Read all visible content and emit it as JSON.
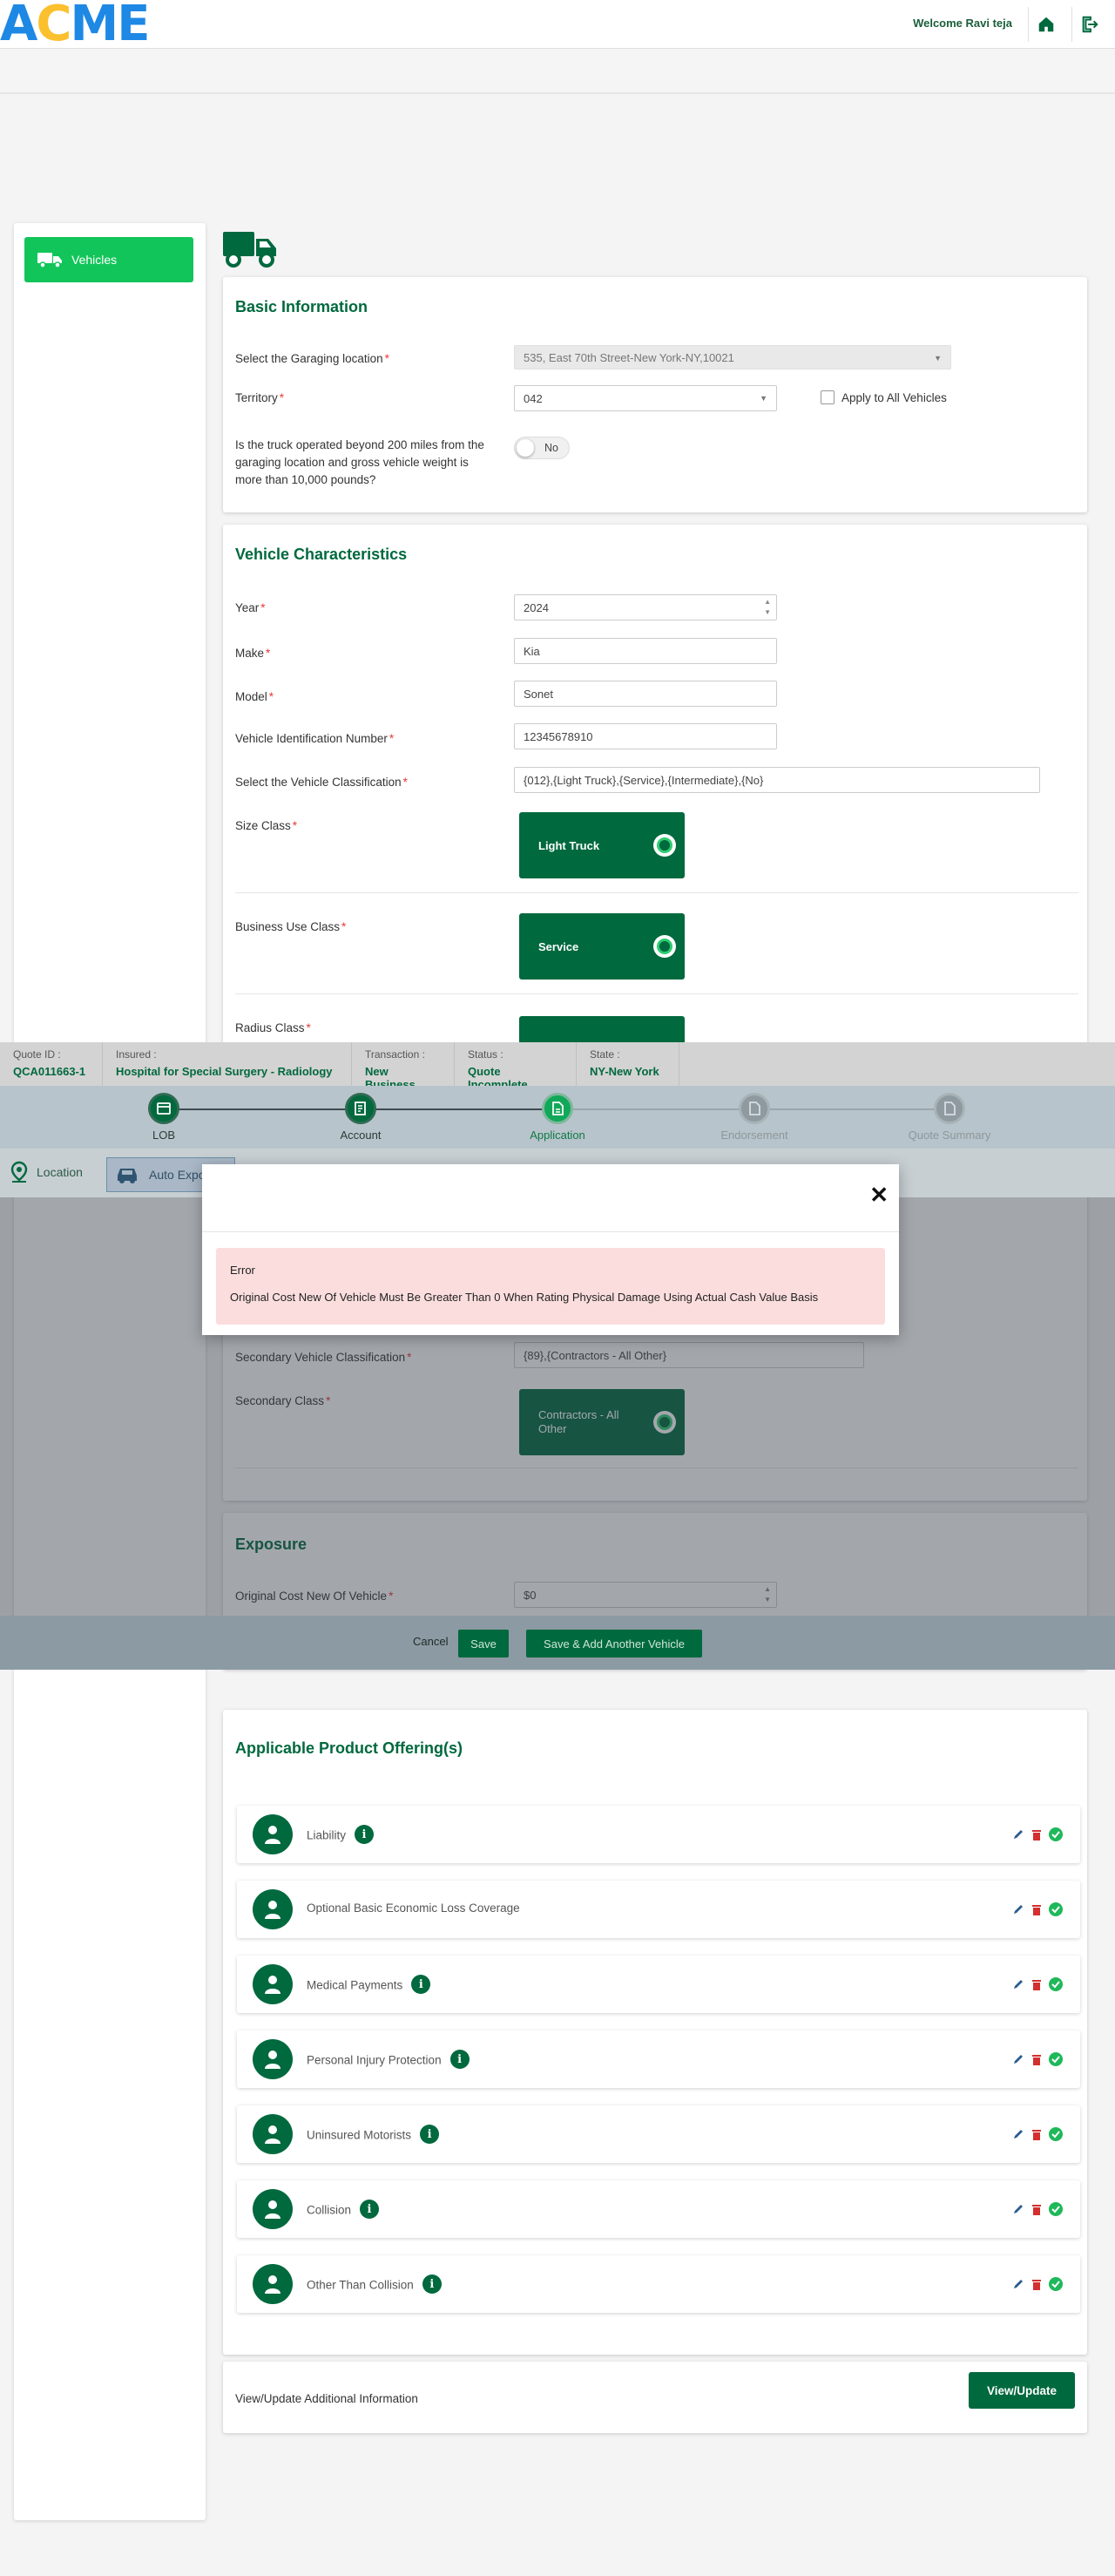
{
  "header": {
    "logo": "ACME",
    "welcome": "Welcome Ravi teja",
    "icons": [
      "home-icon",
      "logout-icon"
    ]
  },
  "sidebar": {
    "items": [
      {
        "label": "Vehicles",
        "icon": "truck-icon"
      }
    ]
  },
  "basic_info": {
    "title": "Basic Information",
    "garaging_label": "Select the Garaging location",
    "garaging_value": "535, East 70th Street-New York-NY,10021",
    "territory_label": "Territory",
    "territory_value": "042",
    "apply_all_label": "Apply to All Vehicles",
    "truck_question": "Is the truck operated beyond 200 miles from the garaging location and gross vehicle weight is more than 10,000 pounds?",
    "truck_toggle": "No"
  },
  "vehicle": {
    "title": "Vehicle Characteristics",
    "year_label": "Year",
    "year_value": "2024",
    "make_label": "Make",
    "make_value": "Kia",
    "model_label": "Model",
    "model_value": "Sonet",
    "vin_label": "Vehicle Identification Number",
    "vin_value": "12345678910",
    "classification_label": "Select the Vehicle Classification",
    "classification_value": "{012},{Light Truck},{Service},{Intermediate},{No}",
    "size_label": "Size Class",
    "size_value": "Light Truck",
    "business_label": "Business Use Class",
    "business_value": "Service",
    "radius_label": "Radius Class",
    "secondary_class_label": "Secondary Vehicle Classification",
    "secondary_class_value": "{89},{Contractors - All Other}",
    "secondary_label": "Secondary Class",
    "secondary_value": "Contractors - All Other"
  },
  "exposure": {
    "title": "Exposure",
    "cost_label": "Original Cost New Of Vehicle",
    "cost_value": "$0"
  },
  "quote_bar": [
    {
      "k": "Quote ID :",
      "v": "QCA011663-1"
    },
    {
      "k": "Insured :",
      "v": "Hospital for Special Surgery - Radiology"
    },
    {
      "k": "Transaction :",
      "v": "New Business"
    },
    {
      "k": "Status :",
      "v": "Quote Incomplete"
    },
    {
      "k": "State :",
      "v": "NY-New York"
    }
  ],
  "steps": [
    {
      "label": "LOB",
      "state": "done"
    },
    {
      "label": "Account",
      "state": "done"
    },
    {
      "label": "Application",
      "state": "active"
    },
    {
      "label": "Endorsement",
      "state": "pending"
    },
    {
      "label": "Quote Summary",
      "state": "pending"
    }
  ],
  "subnav": {
    "location": "Location",
    "auto": "Auto Expos"
  },
  "modal": {
    "error_title": "Error",
    "error_message": "Original Cost New Of Vehicle Must Be Greater Than 0 When Rating Physical Damage Using Actual Cash Value Basis"
  },
  "footer": {
    "cancel": "Cancel",
    "save": "Save",
    "save_add": "Save & Add Another Vehicle"
  },
  "offerings": {
    "title": "Applicable Product Offering(s)",
    "items": [
      {
        "name": "Liability",
        "info": true,
        "icon": "liability-icon"
      },
      {
        "name": "Optional Basic Economic Loss Coverage",
        "info": false,
        "icon": "economic-loss-icon"
      },
      {
        "name": "Medical Payments",
        "info": true,
        "icon": "medical-payments-icon"
      },
      {
        "name": "Personal Injury Protection",
        "info": true,
        "icon": "personal-injury-icon"
      },
      {
        "name": "Uninsured Motorists",
        "info": true,
        "icon": "uninsured-motorists-icon"
      },
      {
        "name": "Collision",
        "info": true,
        "icon": "collision-icon"
      },
      {
        "name": "Other Than Collision",
        "info": true,
        "icon": "other-than-collision-icon"
      }
    ]
  },
  "additional": {
    "label": "View/Update Additional Information",
    "button": "View/Update"
  },
  "colors": {
    "brand_green": "#00693e",
    "accent_green": "#12c55a",
    "logo_blue": "#1e88e5",
    "logo_yellow": "#fbc02d",
    "error_bg": "#fbdddd"
  }
}
